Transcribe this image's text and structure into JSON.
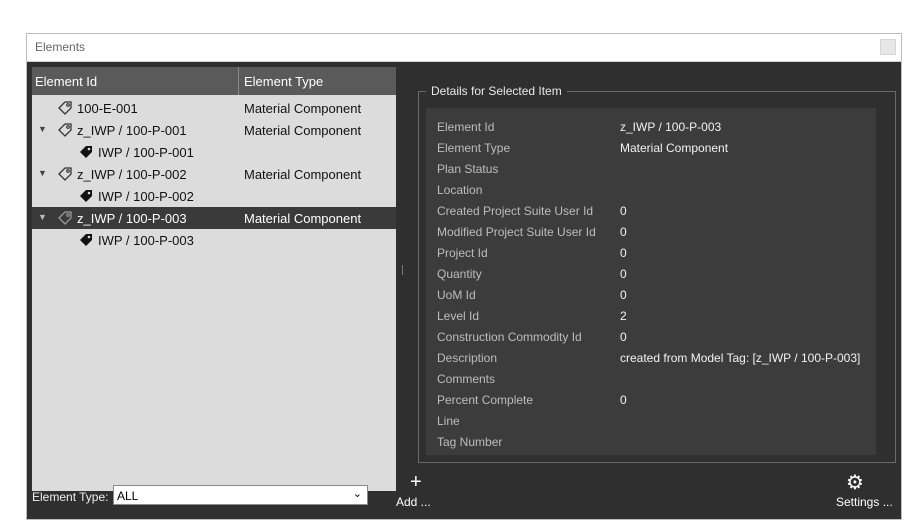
{
  "window": {
    "title": "Elements"
  },
  "table": {
    "headers": {
      "id": "Element Id",
      "type": "Element Type"
    },
    "rows": [
      {
        "id": "100-E-001",
        "type": "Material Component",
        "icon": "tag-outline-icon"
      },
      {
        "id": "z_IWP / 100-P-001",
        "type": "Material Component",
        "icon": "tag-outline-icon",
        "expanded": true
      },
      {
        "id": "IWP / 100-P-001",
        "type": "",
        "icon": "tag-filled-icon"
      },
      {
        "id": "z_IWP / 100-P-002",
        "type": "Material Component",
        "icon": "tag-outline-icon",
        "expanded": true
      },
      {
        "id": "IWP / 100-P-002",
        "type": "",
        "icon": "tag-filled-icon"
      },
      {
        "id": "z_IWP / 100-P-003",
        "type": "Material Component",
        "icon": "tag-outline-icon",
        "expanded": true,
        "selected": true
      },
      {
        "id": "IWP / 100-P-003",
        "type": "",
        "icon": "tag-filled-icon"
      }
    ]
  },
  "details": {
    "title": "Details for Selected Item",
    "fields": [
      {
        "label": "Element Id",
        "value": "z_IWP / 100-P-003"
      },
      {
        "label": "Element Type",
        "value": "Material Component"
      },
      {
        "label": "Plan Status",
        "value": ""
      },
      {
        "label": "Location",
        "value": ""
      },
      {
        "label": "Created Project Suite User Id",
        "value": "0"
      },
      {
        "label": "Modified Project Suite User Id",
        "value": "0"
      },
      {
        "label": "Project Id",
        "value": "0"
      },
      {
        "label": "Quantity",
        "value": "0"
      },
      {
        "label": "UoM Id",
        "value": "0"
      },
      {
        "label": "Level Id",
        "value": "2"
      },
      {
        "label": "Construction Commodity Id",
        "value": "0"
      },
      {
        "label": "Description",
        "value": "created from Model Tag: [z_IWP / 100-P-003]"
      },
      {
        "label": "Comments",
        "value": ""
      },
      {
        "label": "Percent Complete",
        "value": "0"
      },
      {
        "label": "Line",
        "value": ""
      },
      {
        "label": "Tag Number",
        "value": ""
      }
    ]
  },
  "footer": {
    "element_type_label": "Element Type:",
    "element_type_value": "ALL",
    "add_label": "Add ...",
    "settings_label": "Settings ..."
  },
  "colors": {
    "panel_bg": "#2f2f2f",
    "list_bg": "#dcdcdc",
    "selected_row": "#3a3a3a",
    "details_bg": "#3c3c3c"
  }
}
